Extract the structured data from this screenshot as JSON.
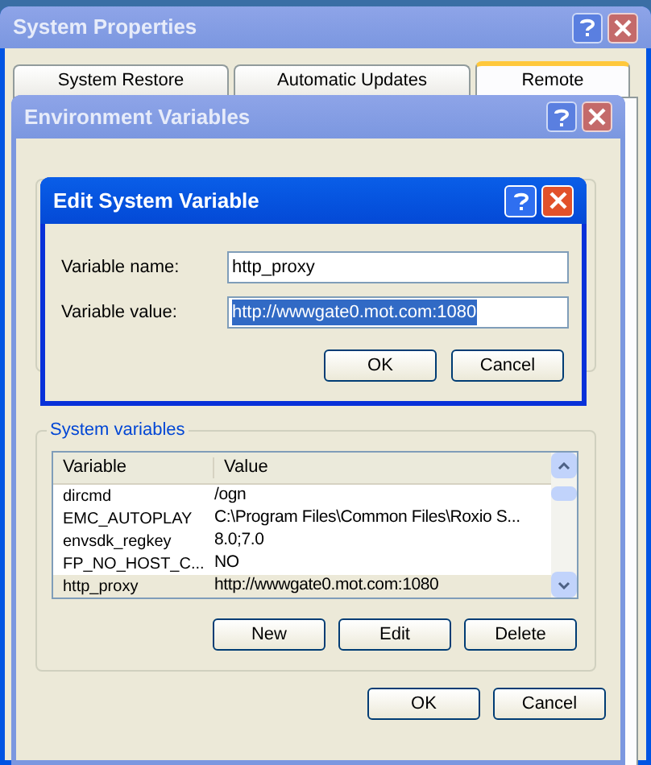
{
  "system_properties": {
    "title": "System Properties",
    "tabs": [
      {
        "label": "System Restore",
        "selected": false
      },
      {
        "label": "Automatic Updates",
        "selected": false
      },
      {
        "label": "Remote",
        "selected": true
      }
    ]
  },
  "environment_variables": {
    "title": "Environment Variables",
    "system_variables": {
      "label": "System variables",
      "columns": [
        "Variable",
        "Value"
      ],
      "rows": [
        {
          "variable": "dircmd",
          "value": "/ogn",
          "selected": false
        },
        {
          "variable": "EMC_AUTOPLAY",
          "value": "C:\\Program Files\\Common Files\\Roxio S...",
          "selected": false
        },
        {
          "variable": "envsdk_regkey",
          "value": "8.0;7.0",
          "selected": false
        },
        {
          "variable": "FP_NO_HOST_C...",
          "value": "NO",
          "selected": false
        },
        {
          "variable": "http_proxy",
          "value": "http://wwwgate0.mot.com:1080",
          "selected": true
        }
      ],
      "buttons": [
        "New",
        "Edit",
        "Delete"
      ]
    },
    "buttons": [
      "OK",
      "Cancel"
    ]
  },
  "edit_system_variable": {
    "title": "Edit System Variable",
    "fields": [
      {
        "label": "Variable name:",
        "value": "http_proxy",
        "selected": false
      },
      {
        "label": "Variable value:",
        "value": "http://wwwgate0.mot.com:1080",
        "selected": true
      }
    ],
    "buttons": [
      "OK",
      "Cancel"
    ]
  }
}
